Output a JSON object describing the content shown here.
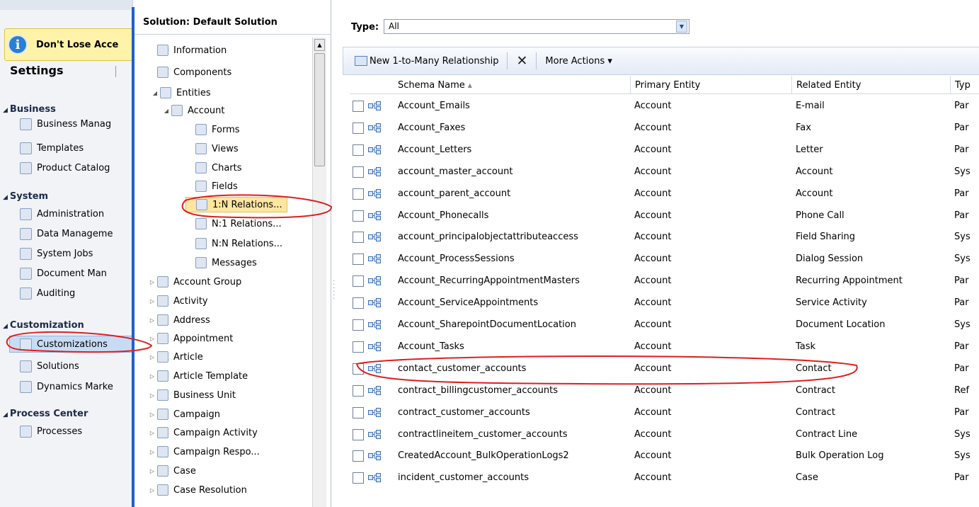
{
  "banner": {
    "text": "Don't Lose Acce",
    "icon": "info-icon"
  },
  "settings": {
    "title": "Settings"
  },
  "left_nav": [
    {
      "section": "Business",
      "items": [
        "Business Manag",
        "Templates",
        "Product Catalog"
      ]
    },
    {
      "section": "System",
      "items": [
        "Administration",
        "Data Manageme",
        "System Jobs",
        "Document Man",
        "Auditing"
      ]
    },
    {
      "section": "Customization",
      "items": [
        "Customizations",
        "Solutions",
        "Dynamics Marke"
      ]
    },
    {
      "section": "Process Center",
      "items": [
        "Processes"
      ]
    }
  ],
  "tree": {
    "title": "Solution: Default Solution",
    "nodes": [
      "Information",
      "Components",
      "Entities",
      "Account",
      "Forms",
      "Views",
      "Charts",
      "Fields",
      "1:N Relations...",
      "N:1 Relations...",
      "N:N Relations...",
      "Messages",
      "Account Group",
      "Activity",
      "Address",
      "Appointment",
      "Article",
      "Article Template",
      "Business Unit",
      "Campaign",
      "Campaign Activity",
      "Campaign Respo...",
      "Case",
      "Case Resolution"
    ]
  },
  "filter": {
    "label": "Type:",
    "value": "All"
  },
  "toolbar": {
    "new_label": "New 1-to-Many Relationship",
    "more_label": "More Actions ▾"
  },
  "grid": {
    "columns": [
      "Schema Name",
      "Primary Entity",
      "Related Entity",
      "Typ"
    ],
    "rows": [
      [
        "Account_Emails",
        "Account",
        "E-mail",
        "Par"
      ],
      [
        "Account_Faxes",
        "Account",
        "Fax",
        "Par"
      ],
      [
        "Account_Letters",
        "Account",
        "Letter",
        "Par"
      ],
      [
        "account_master_account",
        "Account",
        "Account",
        "Sys"
      ],
      [
        "account_parent_account",
        "Account",
        "Account",
        "Par"
      ],
      [
        "Account_Phonecalls",
        "Account",
        "Phone Call",
        "Par"
      ],
      [
        "account_principalobjectattributeaccess",
        "Account",
        "Field Sharing",
        "Sys"
      ],
      [
        "Account_ProcessSessions",
        "Account",
        "Dialog Session",
        "Sys"
      ],
      [
        "Account_RecurringAppointmentMasters",
        "Account",
        "Recurring Appointment",
        "Par"
      ],
      [
        "Account_ServiceAppointments",
        "Account",
        "Service Activity",
        "Par"
      ],
      [
        "Account_SharepointDocumentLocation",
        "Account",
        "Document Location",
        "Sys"
      ],
      [
        "Account_Tasks",
        "Account",
        "Task",
        "Par"
      ],
      [
        "contact_customer_accounts",
        "Account",
        "Contact",
        "Par"
      ],
      [
        "contract_billingcustomer_accounts",
        "Account",
        "Contract",
        "Ref"
      ],
      [
        "contract_customer_accounts",
        "Account",
        "Contract",
        "Par"
      ],
      [
        "contractlineitem_customer_accounts",
        "Account",
        "Contract Line",
        "Sys"
      ],
      [
        "CreatedAccount_BulkOperationLogs2",
        "Account",
        "Bulk Operation Log",
        "Sys"
      ],
      [
        "incident_customer_accounts",
        "Account",
        "Case",
        "Par"
      ]
    ]
  },
  "colors": {
    "highlight_red": "#e01e1e",
    "accent_blue": "#1c5fd4",
    "tree_selected": "#fde6a0"
  }
}
